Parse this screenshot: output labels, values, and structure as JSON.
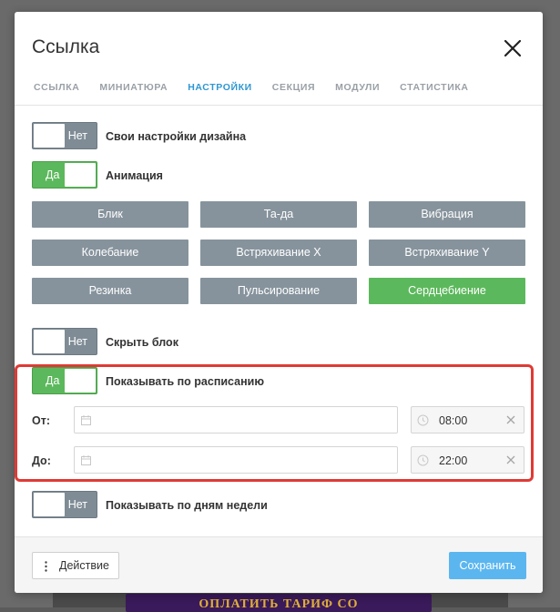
{
  "modal": {
    "title": "Ссылка",
    "tabs": [
      {
        "label": "ССЫЛКА",
        "active": false
      },
      {
        "label": "МИНИАТЮРА",
        "active": false
      },
      {
        "label": "НАСТРОЙКИ",
        "active": true
      },
      {
        "label": "СЕКЦИЯ",
        "active": false
      },
      {
        "label": "МОДУЛИ",
        "active": false
      },
      {
        "label": "СТАТИСТИКА",
        "active": false
      }
    ]
  },
  "settings": {
    "design": {
      "toggle_label": "Нет",
      "state": "off",
      "label": "Свои настройки дизайна"
    },
    "animation": {
      "toggle_label": "Да",
      "state": "on",
      "label": "Анимация"
    },
    "animations": [
      {
        "label": "Блик",
        "selected": false
      },
      {
        "label": "Та-да",
        "selected": false
      },
      {
        "label": "Вибрация",
        "selected": false
      },
      {
        "label": "Колебание",
        "selected": false
      },
      {
        "label": "Встряхивание X",
        "selected": false
      },
      {
        "label": "Встряхивание Y",
        "selected": false
      },
      {
        "label": "Резинка",
        "selected": false
      },
      {
        "label": "Пульсирование",
        "selected": false
      },
      {
        "label": "Сердцебиение",
        "selected": true
      }
    ],
    "hide_block": {
      "toggle_label": "Нет",
      "state": "off",
      "label": "Скрыть блок"
    },
    "schedule": {
      "toggle_label": "Да",
      "state": "on",
      "label": "Показывать по расписанию",
      "from_label": "От:",
      "from_date": "",
      "from_time": "08:00",
      "to_label": "До:",
      "to_date": "",
      "to_time": "22:00"
    },
    "weekdays": {
      "toggle_label": "Нет",
      "state": "off",
      "label": "Показывать по дням недели"
    }
  },
  "footer": {
    "action_label": "Действие",
    "save_label": "Сохранить"
  },
  "background": {
    "banner_text": "ОПЛАТИТЬ ТАРИФ СО"
  },
  "colors": {
    "accent": "#2f97d2",
    "active_green": "#5cb85c",
    "save_blue": "#5bb6ef",
    "highlight_red": "#e03a35"
  }
}
